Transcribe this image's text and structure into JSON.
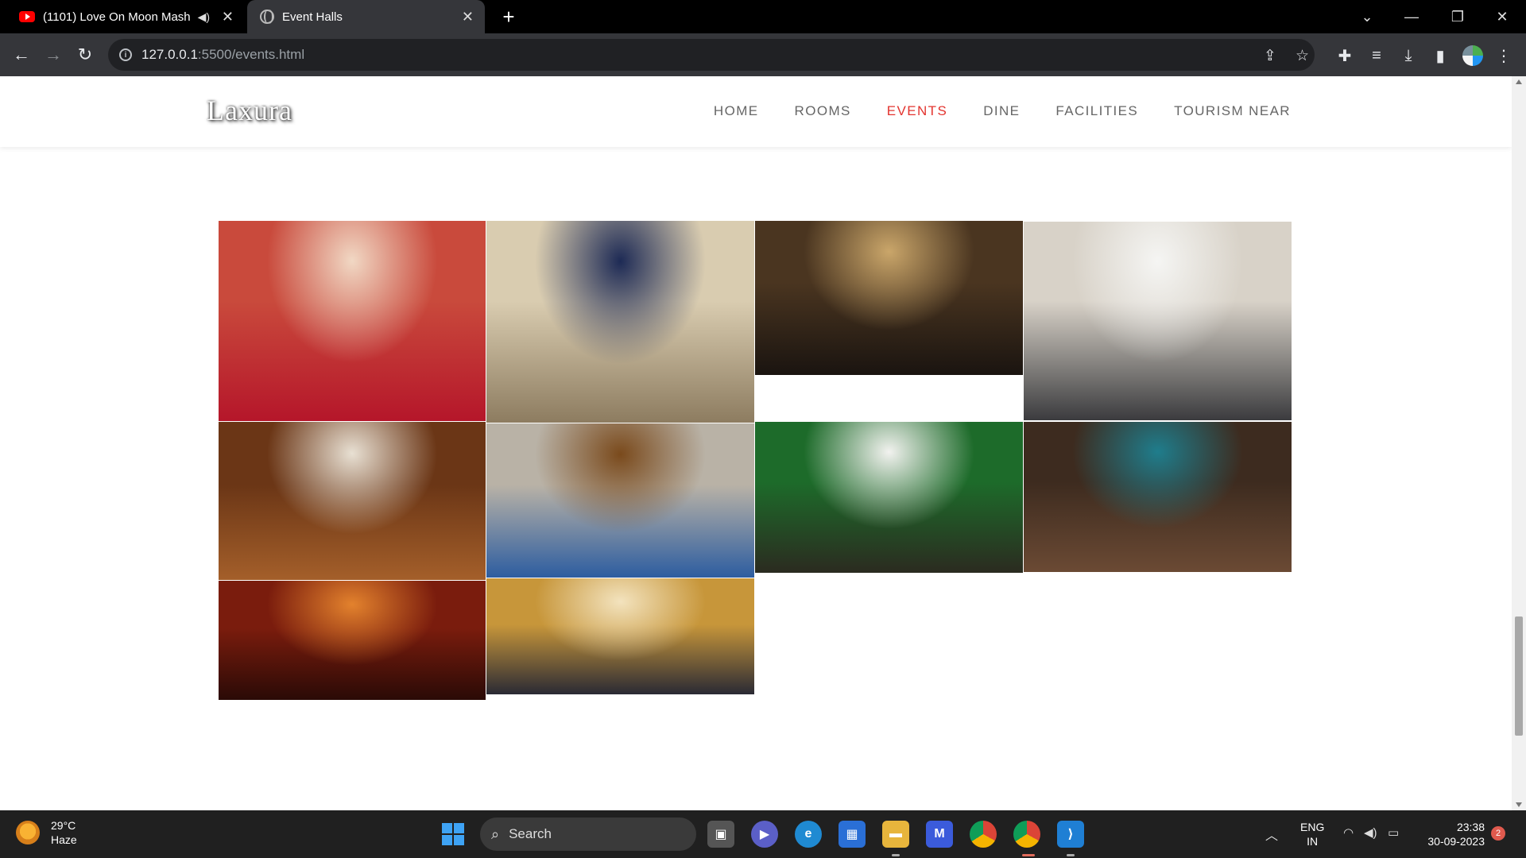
{
  "browser": {
    "tabs": [
      {
        "title": "(1101) Love On Moon Mash",
        "icon": "youtube-icon",
        "audio": "mute-icon"
      },
      {
        "title": "Event Halls",
        "icon": "globe-icon"
      }
    ],
    "new_tab": "+",
    "window_controls": {
      "dropdown": "⌄",
      "minimize": "—",
      "restore": "❐",
      "close": "✕"
    },
    "url_host": "127.0.0.1",
    "url_rest": ":5500/events.html"
  },
  "site": {
    "logo": "Laxura",
    "nav": [
      {
        "label": "HOME",
        "active": false
      },
      {
        "label": "ROOMS",
        "active": false
      },
      {
        "label": "EVENTS",
        "active": true
      },
      {
        "label": "DINE",
        "active": false
      },
      {
        "label": "FACILITIES",
        "active": false
      },
      {
        "label": "TOURISM NEAR",
        "active": false
      }
    ],
    "accent_color": "#e3342f",
    "gallery": [
      {
        "name": "red-banquet-hall-photo",
        "colors": [
          "#c94a3c",
          "#f1d8c4",
          "#b5162a"
        ]
      },
      {
        "name": "blue-chair-ballroom-photo",
        "colors": [
          "#d9ccb0",
          "#1d2a55",
          "#8d7c60"
        ]
      },
      {
        "name": "theater-seating-hall-photo",
        "colors": [
          "#4a3520",
          "#caa66a",
          "#1a1410"
        ]
      },
      {
        "name": "white-round-table-hall-photo",
        "colors": [
          "#d8d2c8",
          "#f5f5f3",
          "#3b3b3e"
        ]
      },
      {
        "name": "wood-panel-dining-hall-photo",
        "colors": [
          "#6b3616",
          "#e8e0d3",
          "#a45f2a"
        ]
      },
      {
        "name": "lecture-conference-room-photo",
        "colors": [
          "#b9b2a6",
          "#7a4a1c",
          "#2d5da0"
        ]
      },
      {
        "name": "outdoor-garden-lawn-photo",
        "colors": [
          "#1d6b2a",
          "#f2f2ef",
          "#2b2b20"
        ]
      },
      {
        "name": "long-table-meeting-room-photo",
        "colors": [
          "#3d2b1f",
          "#1f7d8c",
          "#6b4a34"
        ]
      },
      {
        "name": "orange-lit-event-hall-photo",
        "colors": [
          "#7a1c0d",
          "#e3822d",
          "#2a0a06"
        ]
      },
      {
        "name": "boardroom-table-photo",
        "colors": [
          "#c7963a",
          "#f3e3be",
          "#2a2a34"
        ]
      }
    ]
  },
  "taskbar": {
    "weather_temp": "29°C",
    "weather_desc": "Haze",
    "search_label": "Search",
    "lang_line1": "ENG",
    "lang_line2": "IN",
    "time": "23:38",
    "date": "30-09-2023",
    "notification_count": "2"
  }
}
